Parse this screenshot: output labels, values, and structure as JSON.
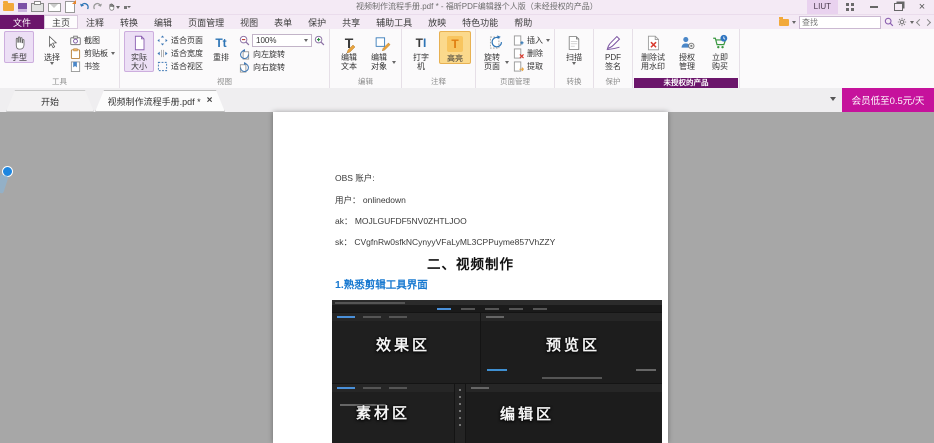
{
  "window": {
    "title": "视频制作流程手册.pdf * - 福昕PDF编辑器个人版（未经授权的产品）",
    "user_badge": "LIUT"
  },
  "quick_access": {
    "items": [
      "open",
      "save",
      "print",
      "email",
      "export",
      "undo",
      "redo",
      "hand-tool",
      "more"
    ]
  },
  "menu": {
    "file_label": "文件",
    "tabs": [
      "主页",
      "注释",
      "转换",
      "编辑",
      "页面管理",
      "视图",
      "表单",
      "保护",
      "共享",
      "辅助工具",
      "放映",
      "特色功能",
      "帮助"
    ],
    "active_tab": "主页",
    "search_placeholder": "查找"
  },
  "ribbon": {
    "groups": [
      {
        "label": "工具",
        "buttons": [
          {
            "label": "手型"
          },
          {
            "label": "选择"
          },
          {
            "label": "截图"
          },
          {
            "label": "剪贴板"
          },
          {
            "label": "书签"
          }
        ]
      },
      {
        "label": "视图",
        "zoom": "100%",
        "buttons": [
          {
            "label": "实际大小"
          },
          {
            "label": "适合页面"
          },
          {
            "label": "适合宽度"
          },
          {
            "label": "适合视区"
          },
          {
            "label": "重排"
          },
          {
            "label": "向左旋转"
          },
          {
            "label": "向右旋转"
          }
        ]
      },
      {
        "label": "编辑",
        "buttons": [
          {
            "label": "编辑文本"
          },
          {
            "label": "编辑对象"
          }
        ]
      },
      {
        "label": "注释",
        "buttons": [
          {
            "label": "打字机"
          },
          {
            "label": "高亮"
          }
        ]
      },
      {
        "label": "页面管理",
        "buttons": [
          {
            "label": "旋转页面"
          },
          {
            "label": "插入"
          },
          {
            "label": "删除"
          },
          {
            "label": "提取"
          }
        ]
      },
      {
        "label": "转换",
        "buttons": [
          {
            "label": "扫描"
          }
        ]
      },
      {
        "label": "保护",
        "buttons": [
          {
            "label": "PDF签名"
          }
        ]
      },
      {
        "label": "未授权的产品",
        "buttons": [
          {
            "label": "删除试用水印"
          },
          {
            "label": "授权管理"
          },
          {
            "label": "立即购买"
          }
        ]
      }
    ]
  },
  "tabbar": {
    "tabs": [
      "开始",
      "视频制作流程手册.pdf *"
    ],
    "member_banner": "会员低至0.5元/天"
  },
  "document": {
    "lines": [
      "OBS 账户:",
      "用户： onlinedown",
      "ak： MOJLGUFDF5NV0ZHTLJOO",
      "sk： CVgfnRw0sfkNCynyyVFaLyML3CPPuyme857VhZZY"
    ],
    "heading": "二、视频制作",
    "subheading": "1.熟悉剪辑工具界面",
    "screenshot_labels": {
      "top_left": "效果区",
      "top_right": "预览区",
      "bottom_left": "素材区",
      "bottom_right": "编辑区"
    }
  },
  "colors": {
    "accent_purple": "#6b156b",
    "ribbon_highlight": "#ecdff5",
    "member_pink": "#c6129c",
    "link_blue": "#1879d0",
    "highlight_amber": "#f8c55f"
  }
}
